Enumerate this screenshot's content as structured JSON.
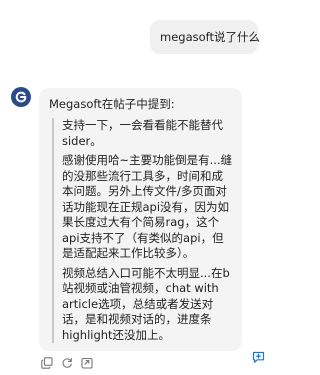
{
  "user_message": {
    "text": "megasoft说了什么"
  },
  "assistant": {
    "avatar_icon": "swirl-logo-icon",
    "intro": "Megasoft在帖子中提到:",
    "quote_paragraphs": [
      "支持一下，一会看看能不能替代sider。",
      "感谢使用哈~主要功能倒是有...缝的没那些流行工具多，时间和成本问题。另外上传文件/多页面对话功能现在正规api没有，因为如果长度过大有个简易rag，这个api支持不了（有类似的api，但是适配起来工作比较多）。",
      "视频总结入口可能不太明显...在b站视频或油管视频，chat with article选项，总结或者发送对话，是和视频对话的，进度条highlight还没加上。"
    ]
  },
  "actions": [
    {
      "name": "copy-button",
      "icon": "copy-icon"
    },
    {
      "name": "regenerate-button",
      "icon": "refresh-icon"
    },
    {
      "name": "share-button",
      "icon": "share-icon"
    }
  ],
  "feedback": {
    "icon": "feedback-chat-icon"
  },
  "colors": {
    "user_bubble": "#f0f0f0",
    "assistant_card": "#f4f4f4",
    "avatar": "#2a4a8a",
    "quote_bar": "#c7c7c7",
    "feedback_icon": "#1a73e8"
  }
}
